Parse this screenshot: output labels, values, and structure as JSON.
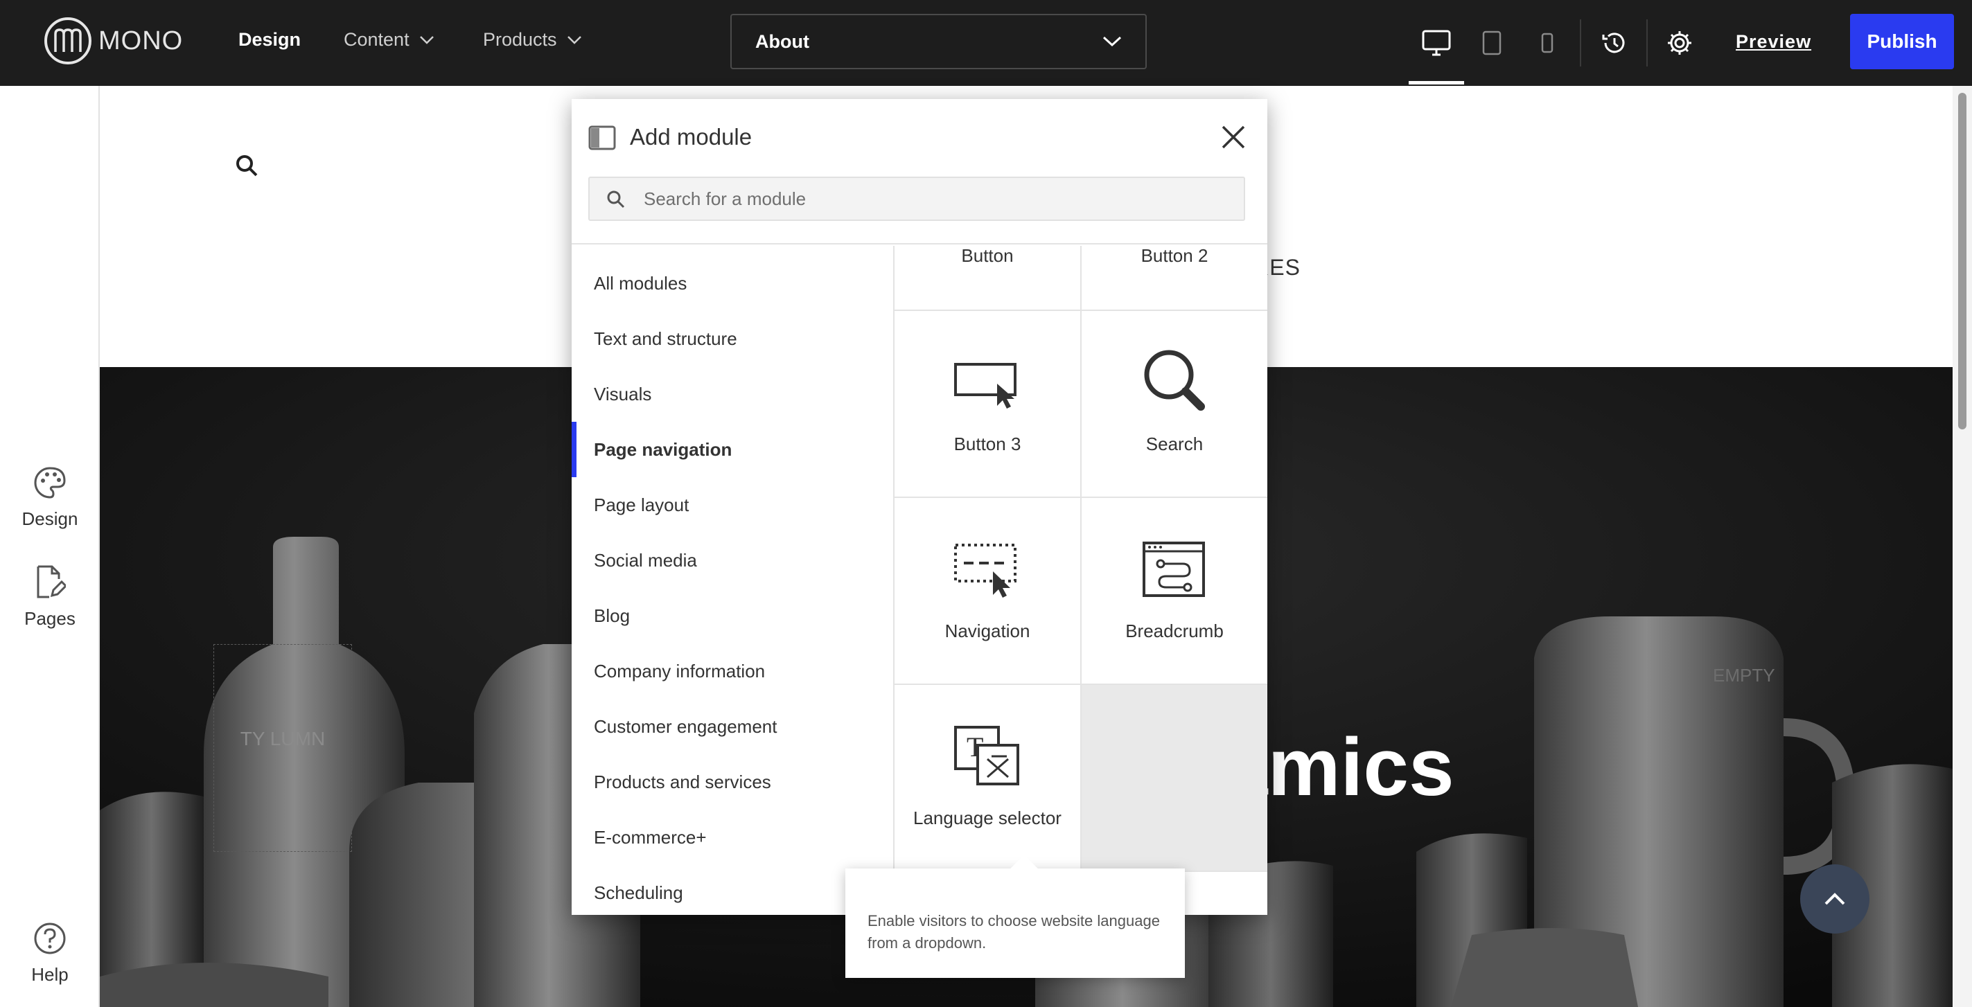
{
  "brand": {
    "logo_text": "MONO"
  },
  "topnav": {
    "design": "Design",
    "content": "Content",
    "products": "Products",
    "page_select": "About",
    "preview": "Preview",
    "publish": "Publish"
  },
  "sidebar": {
    "design": "Design",
    "pages": "Pages",
    "help": "Help"
  },
  "site": {
    "nav_fragment": "URES",
    "hero_title_fragment": "amics",
    "empty_column": "TY LUMN",
    "empty_right": "EMPTY"
  },
  "modal": {
    "title": "Add module",
    "search_placeholder": "Search for a module",
    "categories": [
      "All modules",
      "Text and structure",
      "Visuals",
      "Page navigation",
      "Page layout",
      "Social media",
      "Blog",
      "Company information",
      "Customer engagement",
      "Products and services",
      "E-commerce+",
      "Scheduling"
    ],
    "active_category": "Page navigation",
    "modules": [
      {
        "label": "Button",
        "icon": "button-icon"
      },
      {
        "label": "Button 2",
        "icon": "button-2-icon"
      },
      {
        "label": "Button 3",
        "icon": "button-3-icon"
      },
      {
        "label": "Search",
        "icon": "search-module-icon"
      },
      {
        "label": "Navigation",
        "icon": "navigation-icon"
      },
      {
        "label": "Breadcrumb",
        "icon": "breadcrumb-icon"
      },
      {
        "label": "Language selector",
        "icon": "language-selector-icon"
      }
    ]
  },
  "tooltip": {
    "text": "Enable visitors to choose website language from a dropdown."
  },
  "colors": {
    "accent": "#2a3bf0",
    "topbar": "#1d1d1d"
  }
}
